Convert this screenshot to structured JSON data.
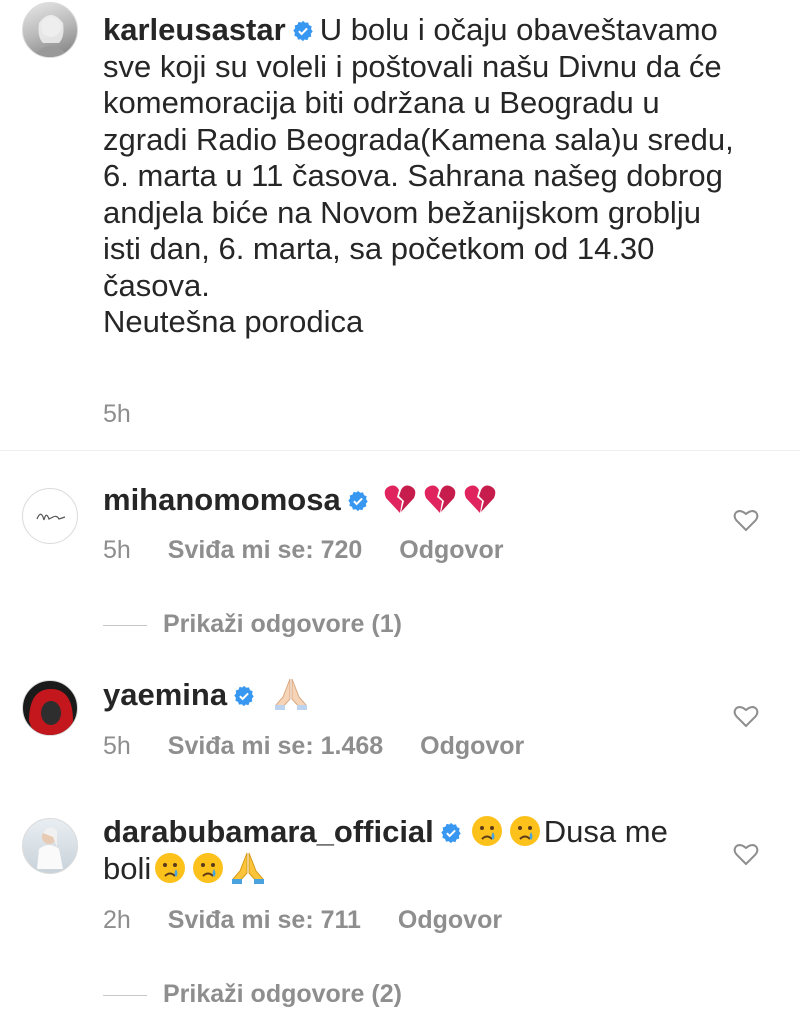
{
  "caption": {
    "username": "karleusastar",
    "text": "U bolu i očaju obaveštavamo sve koji su voleli i poštovali našu Divnu da će komemoracija biti održana u Beogradu u zgradi Radio Beograda(Kamena sala)u sredu, 6. marta u 11 časova. Sahrana našeg dobrog andjela biće na Novom bežanijskom groblju isti dan, 6. marta, sa početkom od 14.30 časova.",
    "signature": "Neutešna porodica",
    "time": "5h"
  },
  "comments": [
    {
      "username": "mihanomomosa",
      "text": "",
      "emoji": [
        "heartbreak-icon",
        "heartbreak-icon",
        "heartbreak-icon"
      ],
      "time": "5h",
      "likes": "Sviđa mi se: 720",
      "reply": "Odgovor",
      "view_replies": "Prikaži odgovore (1)"
    },
    {
      "username": "yaemina",
      "text": "",
      "emoji": [
        "pray-icon"
      ],
      "time": "5h",
      "likes": "Sviđa mi se: 1.468",
      "reply": "Odgovor",
      "view_replies": ""
    },
    {
      "username": "darabubamara_official",
      "text_1": "Dusa me",
      "text_2": "boli",
      "time": "2h",
      "likes": "Sviđa mi se: 711",
      "reply": "Odgovor",
      "view_replies": "Prikaži odgovore (2)"
    }
  ],
  "colors": {
    "text": "#262626",
    "muted": "#8e8e8e",
    "verified": "#3897f0",
    "heartbreak": "#e0245e"
  }
}
